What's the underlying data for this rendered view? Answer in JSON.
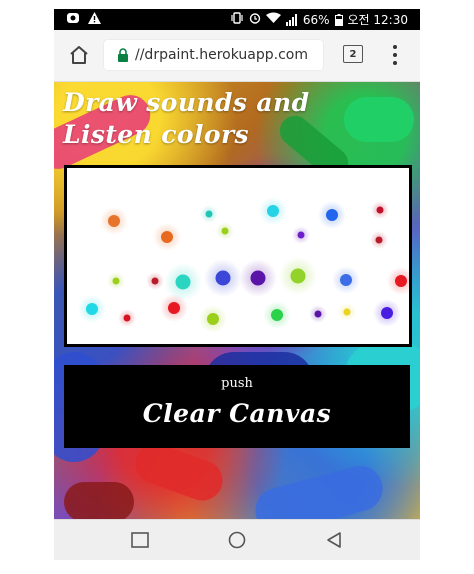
{
  "status_bar": {
    "left_icons": [
      "notification-app-icon",
      "warning-icon"
    ],
    "battery_percent": "66%",
    "time": "오전 12:30",
    "icons": [
      "vibrate-icon",
      "alarm-icon",
      "wifi-icon",
      "signal-icon",
      "battery-icon"
    ]
  },
  "browser": {
    "url": "//drpaint.herokuapp.com",
    "tab_count": "2",
    "icons": [
      "home-icon",
      "lock-icon",
      "tabs-icon",
      "overflow-menu-icon"
    ]
  },
  "page": {
    "headline": "Draw sounds and\nListen colors",
    "button": {
      "push_label": "push",
      "main_label": "Clear Canvas"
    },
    "canvas_dots": [
      {
        "color": "#e8732a",
        "size": "medium"
      },
      {
        "color": "#20c5b5",
        "size": "small"
      },
      {
        "color": "#24d3e6",
        "size": "medium"
      },
      {
        "color": "#2266ee",
        "size": "medium"
      },
      {
        "color": "#c0102a",
        "size": "small"
      },
      {
        "color": "#e86a20",
        "size": "medium"
      },
      {
        "color": "#9ccf1c",
        "size": "small"
      },
      {
        "color": "#6d20c8",
        "size": "small"
      },
      {
        "color": "#b81c2a",
        "size": "small"
      },
      {
        "color": "#2ad6c2",
        "size": "large"
      },
      {
        "color": "#3a47d8",
        "size": "large"
      },
      {
        "color": "#5b14a8",
        "size": "large"
      },
      {
        "color": "#92d22a",
        "size": "large"
      },
      {
        "color": "#3d6de6",
        "size": "medium"
      },
      {
        "color": "#e81822",
        "size": "medium"
      },
      {
        "color": "#9ccf1c",
        "size": "small"
      },
      {
        "color": "#b81c2a",
        "size": "small"
      },
      {
        "color": "#20d9e6",
        "size": "medium"
      },
      {
        "color": "#d81420",
        "size": "small"
      },
      {
        "color": "#e81822",
        "size": "medium"
      },
      {
        "color": "#9ccf1c",
        "size": "medium"
      },
      {
        "color": "#2ad24a",
        "size": "medium"
      },
      {
        "color": "#5b14a8",
        "size": "small"
      },
      {
        "color": "#e8d420",
        "size": "small"
      },
      {
        "color": "#4a1ce0",
        "size": "medium"
      }
    ]
  },
  "nav_bar": {
    "icons": [
      "recent-apps-icon",
      "home-circle-icon",
      "back-icon"
    ]
  }
}
